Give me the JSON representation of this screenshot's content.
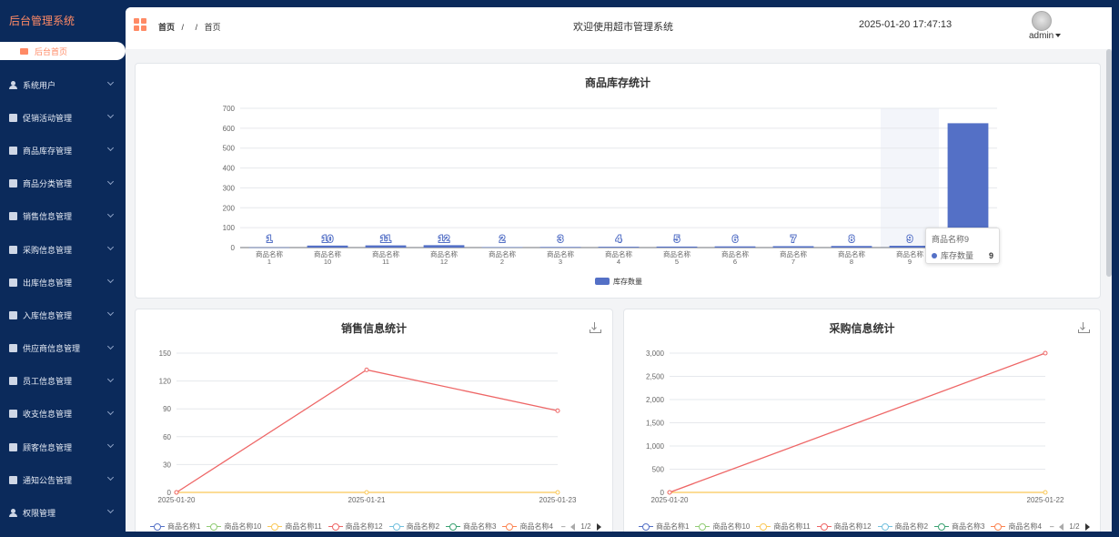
{
  "sidebar": {
    "brand": "后台管理系统",
    "home_label": "后台首页",
    "items": [
      {
        "label": "系统用户",
        "icon": "user-icon"
      },
      {
        "label": "促销活动管理",
        "icon": "list-icon"
      },
      {
        "label": "商品库存管理",
        "icon": "list-icon"
      },
      {
        "label": "商品分类管理",
        "icon": "list-icon"
      },
      {
        "label": "销售信息管理",
        "icon": "list-icon"
      },
      {
        "label": "采购信息管理",
        "icon": "list-icon"
      },
      {
        "label": "出库信息管理",
        "icon": "list-icon"
      },
      {
        "label": "入库信息管理",
        "icon": "list-icon"
      },
      {
        "label": "供应商信息管理",
        "icon": "list-icon"
      },
      {
        "label": "员工信息管理",
        "icon": "list-icon"
      },
      {
        "label": "收支信息管理",
        "icon": "list-icon"
      },
      {
        "label": "顾客信息管理",
        "icon": "list-icon"
      },
      {
        "label": "通知公告管理",
        "icon": "list-icon"
      },
      {
        "label": "权限管理",
        "icon": "user-icon"
      }
    ]
  },
  "header": {
    "breadcrumb_home": "首页",
    "breadcrumb_sep1": "/",
    "breadcrumb_sep2": "/",
    "breadcrumb_current": "首页",
    "welcome": "欢迎使用超市管理系统",
    "datetime": "2025-01-20 17:47:13",
    "user": "admin"
  },
  "colors": {
    "accent": "#ff8a65",
    "sidebar_bg": "#0b2a5b",
    "bar": "#5470c6",
    "series": [
      "#5470c6",
      "#91cc75",
      "#fac858",
      "#ee6666",
      "#73c0de",
      "#3ba272",
      "#fc8452"
    ]
  },
  "chart_data": [
    {
      "type": "bar",
      "title": "商品库存统计",
      "categories": [
        "商品名称\n1",
        "商品名称\n10",
        "商品名称\n11",
        "商品名称\n12",
        "商品名称\n2",
        "商品名称\n3",
        "商品名称\n4",
        "商品名称\n5",
        "商品名称\n6",
        "商品名称\n7",
        "商品名称\n8",
        "商品名称\n9",
        ""
      ],
      "series": [
        {
          "name": "库存数量",
          "values": [
            1,
            10,
            11,
            12,
            2,
            3,
            4,
            5,
            6,
            7,
            8,
            9,
            625
          ]
        }
      ],
      "data_labels": [
        "1",
        "10",
        "11",
        "12",
        "2",
        "3",
        "4",
        "5",
        "6",
        "7",
        "8",
        "9",
        ""
      ],
      "ylim": [
        0,
        700
      ],
      "yticks": [
        0,
        100,
        200,
        300,
        400,
        500,
        600,
        700
      ],
      "grid": true,
      "legend": "bottom-center",
      "highlighted_index": 11,
      "tooltip": {
        "title": "商品名称9",
        "label": "库存数量",
        "value": "9"
      }
    },
    {
      "type": "line",
      "title": "销售信息统计",
      "x": [
        "2025-01-20",
        "2025-01-21",
        "2025-01-23"
      ],
      "series": [
        {
          "name": "商品名称12",
          "color_index": 3,
          "values": [
            0,
            132,
            88
          ]
        },
        {
          "name": "商品名称11",
          "color_index": 2,
          "values": [
            0,
            0,
            0
          ]
        }
      ],
      "legend_items": [
        "商品名称1",
        "商品名称10",
        "商品名称11",
        "商品名称12",
        "商品名称2",
        "商品名称3",
        "商品名称4"
      ],
      "legend_page": "1/2",
      "ylim": [
        0,
        150
      ],
      "yticks": [
        0,
        30,
        60,
        90,
        120,
        150
      ],
      "grid": true,
      "legend": "bottom"
    },
    {
      "type": "line",
      "title": "采购信息统计",
      "x": [
        "2025-01-20",
        "2025-01-22"
      ],
      "series": [
        {
          "name": "商品名称12",
          "color_index": 3,
          "values": [
            0,
            3000
          ]
        },
        {
          "name": "商品名称11",
          "color_index": 2,
          "values": [
            0,
            0
          ]
        }
      ],
      "legend_items": [
        "商品名称1",
        "商品名称10",
        "商品名称11",
        "商品名称12",
        "商品名称2",
        "商品名称3",
        "商品名称4"
      ],
      "legend_page": "1/2",
      "ylim": [
        0,
        3000
      ],
      "yticks": [
        0,
        500,
        1000,
        1500,
        2000,
        2500,
        3000
      ],
      "ytick_labels": [
        "0",
        "500",
        "1,000",
        "1,500",
        "2,000",
        "2,500",
        "3,000"
      ],
      "grid": true,
      "legend": "bottom"
    }
  ]
}
